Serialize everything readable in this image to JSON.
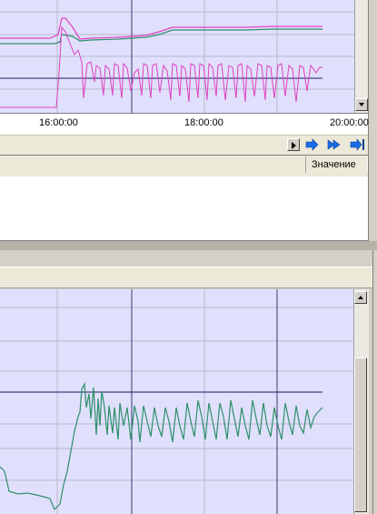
{
  "time_axis": {
    "ticks": [
      "16:00:00",
      "18:00:00",
      "20:00:00"
    ]
  },
  "grid": {
    "column_header": "Значение"
  },
  "colors": {
    "plot_background": "#e0e0fc",
    "series_magenta": "#e040c0",
    "series_teal": "#2e8f6a",
    "setpoint_line": "#1a1a5e",
    "grid_line": "#b8b8cc",
    "nav_arrow": "#1a6ee8"
  },
  "icons": {
    "nav_step_forward": "play-step-icon",
    "nav_forward": "arrow-right-icon",
    "nav_fast_forward": "double-arrow-right-icon",
    "nav_end": "arrow-to-end-icon",
    "scroll_up": "arrow-up-icon",
    "scroll_down": "arrow-down-icon"
  }
}
